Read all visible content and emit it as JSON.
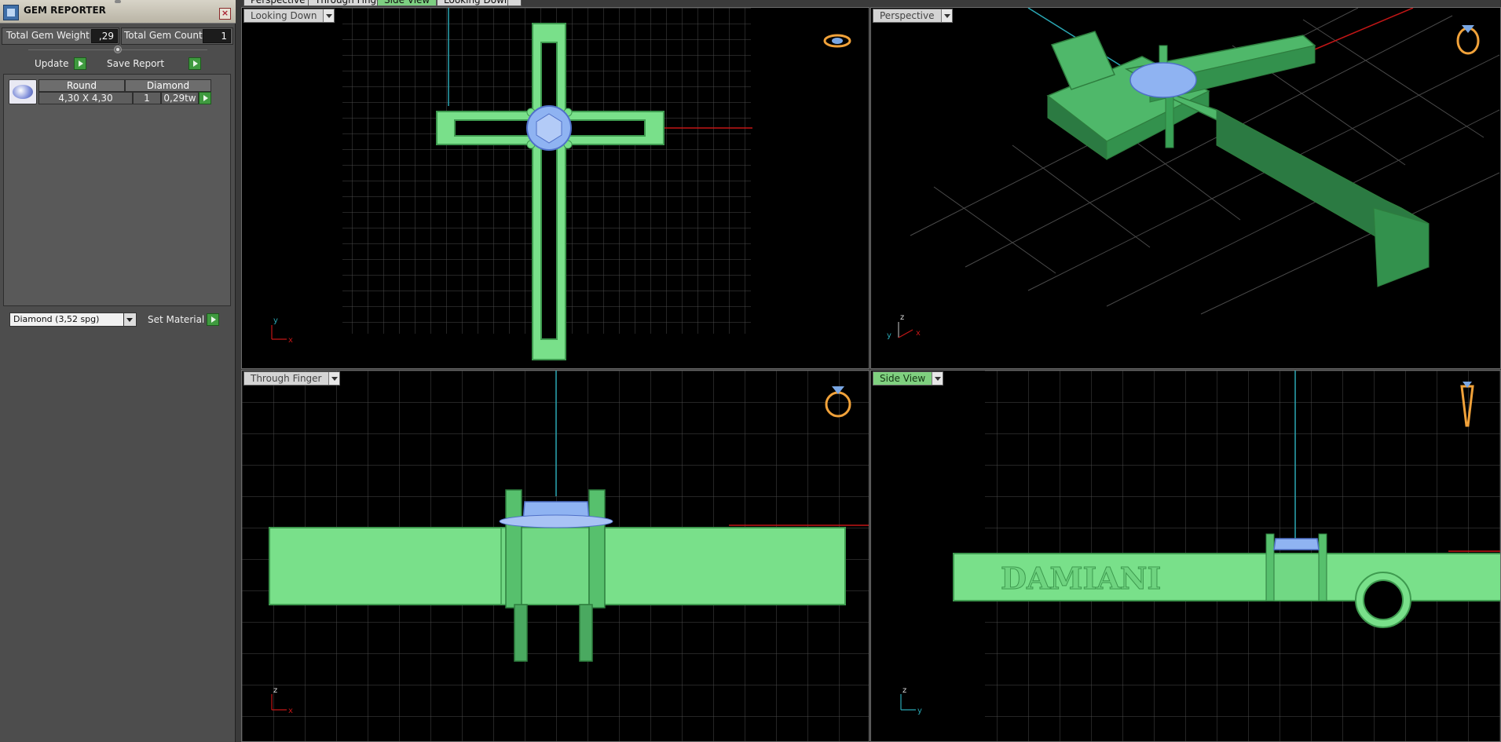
{
  "gem_reporter": {
    "title": "GEM REPORTER",
    "total_weight_label": "Total Gem Weight",
    "total_weight_value": ",29",
    "total_count_label": "Total Gem Count",
    "total_count_value": "1",
    "update_label": "Update",
    "save_report_label": "Save Report",
    "grid": {
      "shape": "Round",
      "stone": "Diamond",
      "size": "4,30 X 4,30",
      "qty": "1",
      "weight": "0,29tw"
    },
    "material_selected": "Diamond    (3,52 spg)",
    "set_material_label": "Set Material"
  },
  "tabs": [
    "Perspective",
    "Through Finger",
    "Side View",
    "Looking Down"
  ],
  "active_tab": "Side View",
  "viewports": {
    "top_left": {
      "label": "Looking Down",
      "axis_v": "y",
      "axis_h": "x"
    },
    "top_right": {
      "label": "Perspective",
      "axis_v": "z",
      "axis_h": "x",
      "axis_extra": "y"
    },
    "bottom_left": {
      "label": "Through Finger",
      "axis_v": "z",
      "axis_h": "x"
    },
    "bottom_right": {
      "label": "Side View",
      "axis_v": "z",
      "axis_h": "y",
      "engraving": "DAMIANI"
    }
  },
  "colors": {
    "model_green": "#79e08a",
    "gem_blue": "#8fb3f2",
    "grid": "#4a4a4a",
    "axis_red": "#c21616",
    "axis_cyan": "#2aa7b4"
  }
}
